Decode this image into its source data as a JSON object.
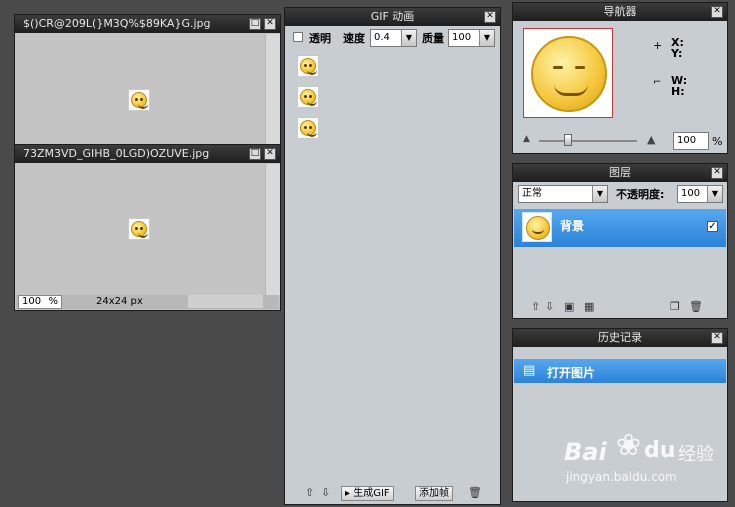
{
  "doc1": {
    "title": "$()CR@209L(}M3Q%$89KA}G.jpg"
  },
  "doc2": {
    "title": "73ZM3VD_GIHB_0LGD)OZUVE.jpg",
    "zoom": "100",
    "zoom_unit": "%",
    "size": "24x24 px"
  },
  "gif_panel": {
    "title": "GIF 动画",
    "transparent_label": "透明",
    "speed_label": "速度",
    "speed_value": "0.4",
    "quality_label": "质量",
    "quality_value": "100",
    "generate_label": "生成GIF",
    "add_frame_label": "添加帧"
  },
  "navigator": {
    "title": "导航器",
    "x_label": "X:",
    "y_label": "Y:",
    "w_label": "W:",
    "h_label": "H:",
    "zoom_value": "100",
    "zoom_unit": "%",
    "zoom_level": 0.25
  },
  "layers": {
    "title": "图层",
    "blend_mode": "正常",
    "opacity_label": "不透明度:",
    "opacity_value": "100",
    "layer_name": "背景"
  },
  "history": {
    "title": "历史记录",
    "item": "打开图片"
  },
  "watermark": {
    "brand": "Bai",
    "brand2": "du",
    "site_cn": "经验",
    "url": "jingyan.baidu.com"
  },
  "colors": {
    "selection": "#2b83d8",
    "panel_bg": "#c8cdd2",
    "titlebar": "#1e1e1e"
  }
}
